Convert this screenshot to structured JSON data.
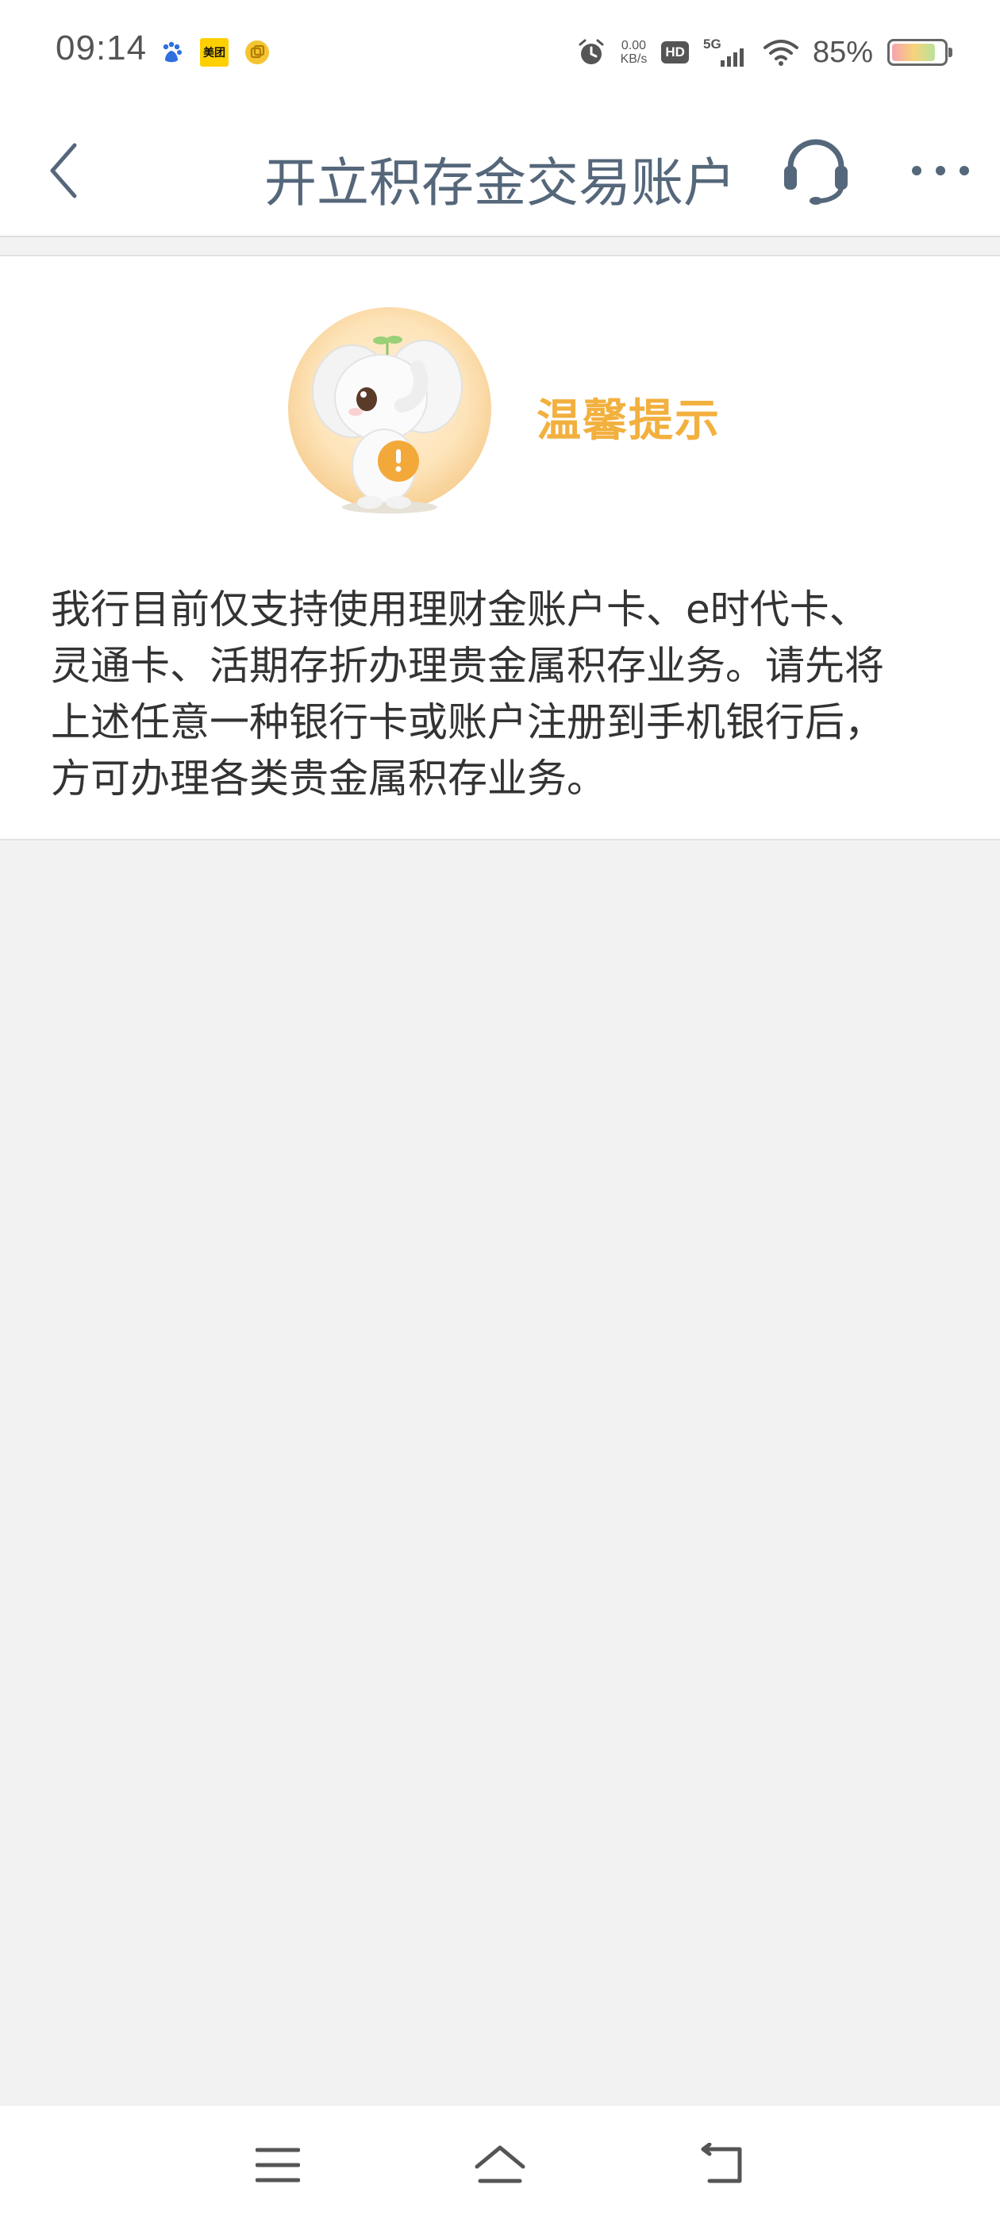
{
  "status_bar": {
    "time": "09:14",
    "app_icons": [
      "baidu-icon",
      "meituan-icon",
      "coin-app-icon"
    ],
    "meituan_label": "美团",
    "net_speed_value": "0.00",
    "net_speed_unit": "KB/s",
    "hd_label": "HD",
    "network_label": "5G",
    "battery_percent": "85%",
    "battery_level": 0.85
  },
  "nav": {
    "title": "开立积存金交易账户",
    "back_icon": "chevron-left-icon",
    "support_icon": "headset-icon",
    "more_icon": "more-dots-icon"
  },
  "notice": {
    "heading": "温馨提示",
    "mascot_icon": "elephant-mascot-icon",
    "body_lines": [
      "我行目前仅支持使用理财金账户卡、e时代卡、",
      "灵通卡、活期存折办理贵金属积存业务。请先将",
      "上述任意一种银行卡或账户注册到手机银行后，",
      "方可办理各类贵金属积存业务。"
    ]
  },
  "system_nav": {
    "menu_icon": "menu-icon",
    "home_icon": "home-icon",
    "back_icon": "back-arrow-icon"
  },
  "colors": {
    "title": "#55677a",
    "heading_accent": "#f2b03e",
    "page_background": "#f2f2f2",
    "body_text": "#333333"
  }
}
